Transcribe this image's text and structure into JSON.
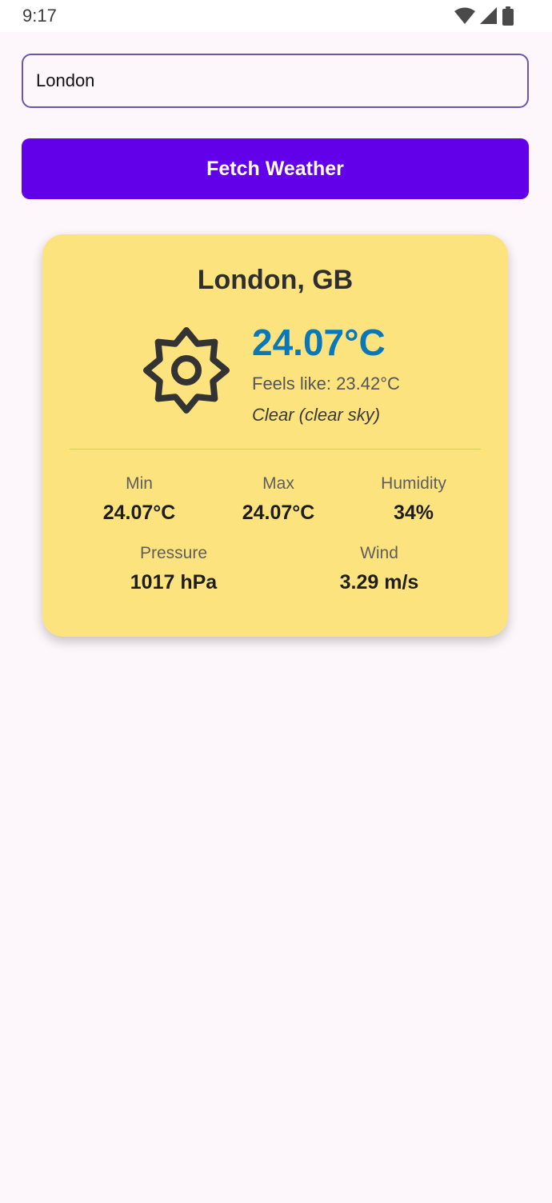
{
  "status_bar": {
    "time": "9:17",
    "icons": [
      "wifi-icon",
      "signal-icon",
      "battery-icon"
    ]
  },
  "search": {
    "value": "London"
  },
  "fetch_button": {
    "label": "Fetch Weather"
  },
  "weather": {
    "location": "London, GB",
    "icon": "sun-icon",
    "temperature": "24.07°C",
    "feels_like": "Feels like: 23.42°C",
    "description": "Clear (clear sky)",
    "stats": {
      "min": {
        "label": "Min",
        "value": "24.07°C"
      },
      "max": {
        "label": "Max",
        "value": "24.07°C"
      },
      "humidity": {
        "label": "Humidity",
        "value": "34%"
      },
      "pressure": {
        "label": "Pressure",
        "value": "1017 hPa"
      },
      "wind": {
        "label": "Wind",
        "value": "3.29 m/s"
      }
    }
  },
  "colors": {
    "accent": "#6200ea",
    "card": "#fde37e",
    "temperature": "#0878b8",
    "background": "#fdf7fb"
  }
}
